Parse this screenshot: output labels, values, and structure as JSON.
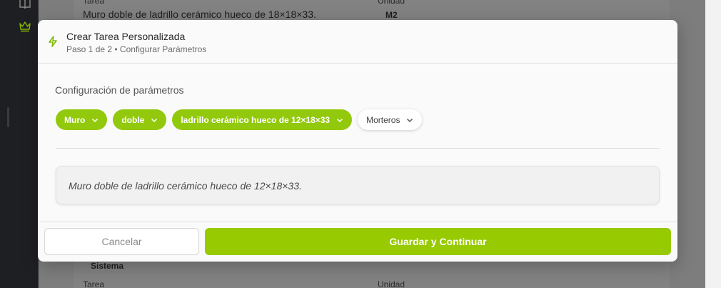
{
  "background": {
    "top_card": {
      "col_task_header": "Tarea",
      "col_unit_header": "Unidad",
      "task_text": "Muro doble de ladrillo cerámico hueco de 18×18×33.",
      "unit_text": "M2"
    },
    "bottom_card": {
      "section_label": "Sistema",
      "col_task_header": "Tarea",
      "col_unit_header": "Unidad"
    },
    "sidebar_icons": [
      "book-icon",
      "crown-icon"
    ]
  },
  "modal": {
    "title": "Crear Tarea Personalizada",
    "subtitle": "Paso 1 de 2 • Configurar Parámetros",
    "header_icon": "lightning-icon",
    "section_label": "Configuración de parámetros",
    "chips": [
      {
        "label": "Muro",
        "style": "selected"
      },
      {
        "label": "doble",
        "style": "selected"
      },
      {
        "label": "ladrillo cerámico hueco de 12×18×33",
        "style": "selected"
      },
      {
        "label": "Morteros",
        "style": "unselected"
      }
    ],
    "preview_text": "Muro doble de ladrillo cerámico hueco de 12×18×33.",
    "cancel_label": "Cancelar",
    "save_label": "Guardar y Continuar"
  },
  "colors": {
    "accent": "#97ca00",
    "chip_selected": "#92c90c"
  }
}
